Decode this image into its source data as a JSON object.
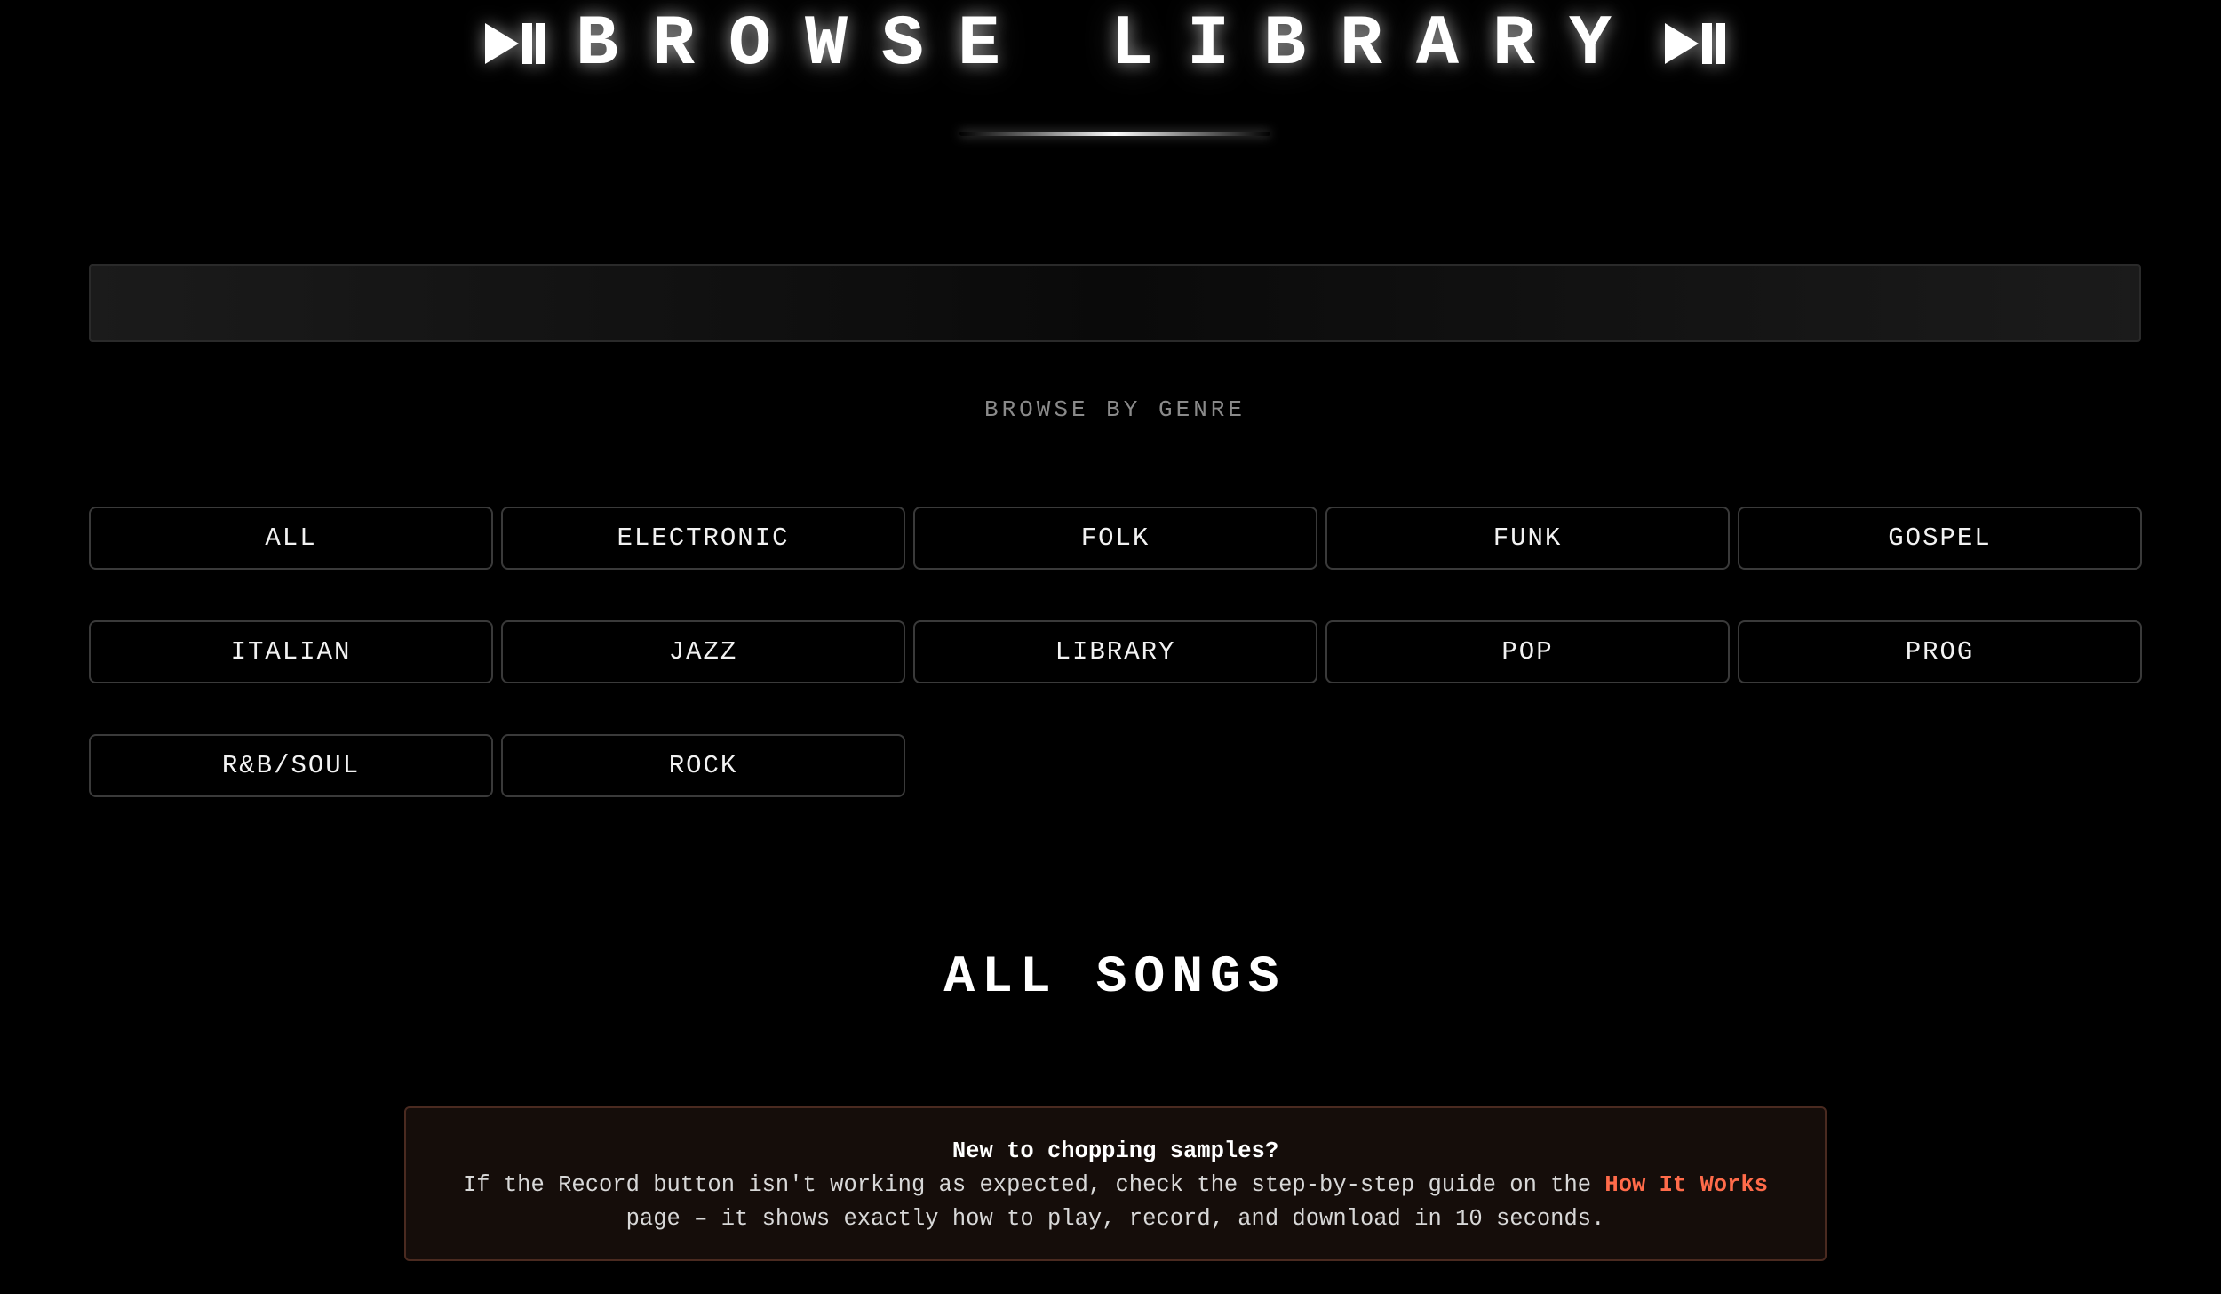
{
  "header": {
    "title": "BROWSE LIBRARY",
    "left_icon": "play-pause-icon",
    "right_icon": "play-pause-icon"
  },
  "search": {
    "value": "",
    "placeholder": ""
  },
  "genres": {
    "heading": "BROWSE BY GENRE",
    "items": [
      "ALL",
      "ELECTRONIC",
      "FOLK",
      "FUNK",
      "GOSPEL",
      "ITALIAN",
      "JAZZ",
      "LIBRARY",
      "POP",
      "PROG",
      "R&B/SOUL",
      "ROCK"
    ]
  },
  "songs": {
    "title": "ALL SONGS"
  },
  "notice": {
    "title": "New to chopping samples?",
    "text_before_link": "If the Record button isn't working as expected, check the step-by-step guide on the ",
    "link_label": "How It Works",
    "text_after_link": "page – it shows exactly how to play, record, and download in 10 seconds."
  },
  "colors": {
    "background": "#000000",
    "accent_link": "#ff6b4a",
    "notice_background": "#150d0a",
    "notice_border": "#4a2a20"
  }
}
